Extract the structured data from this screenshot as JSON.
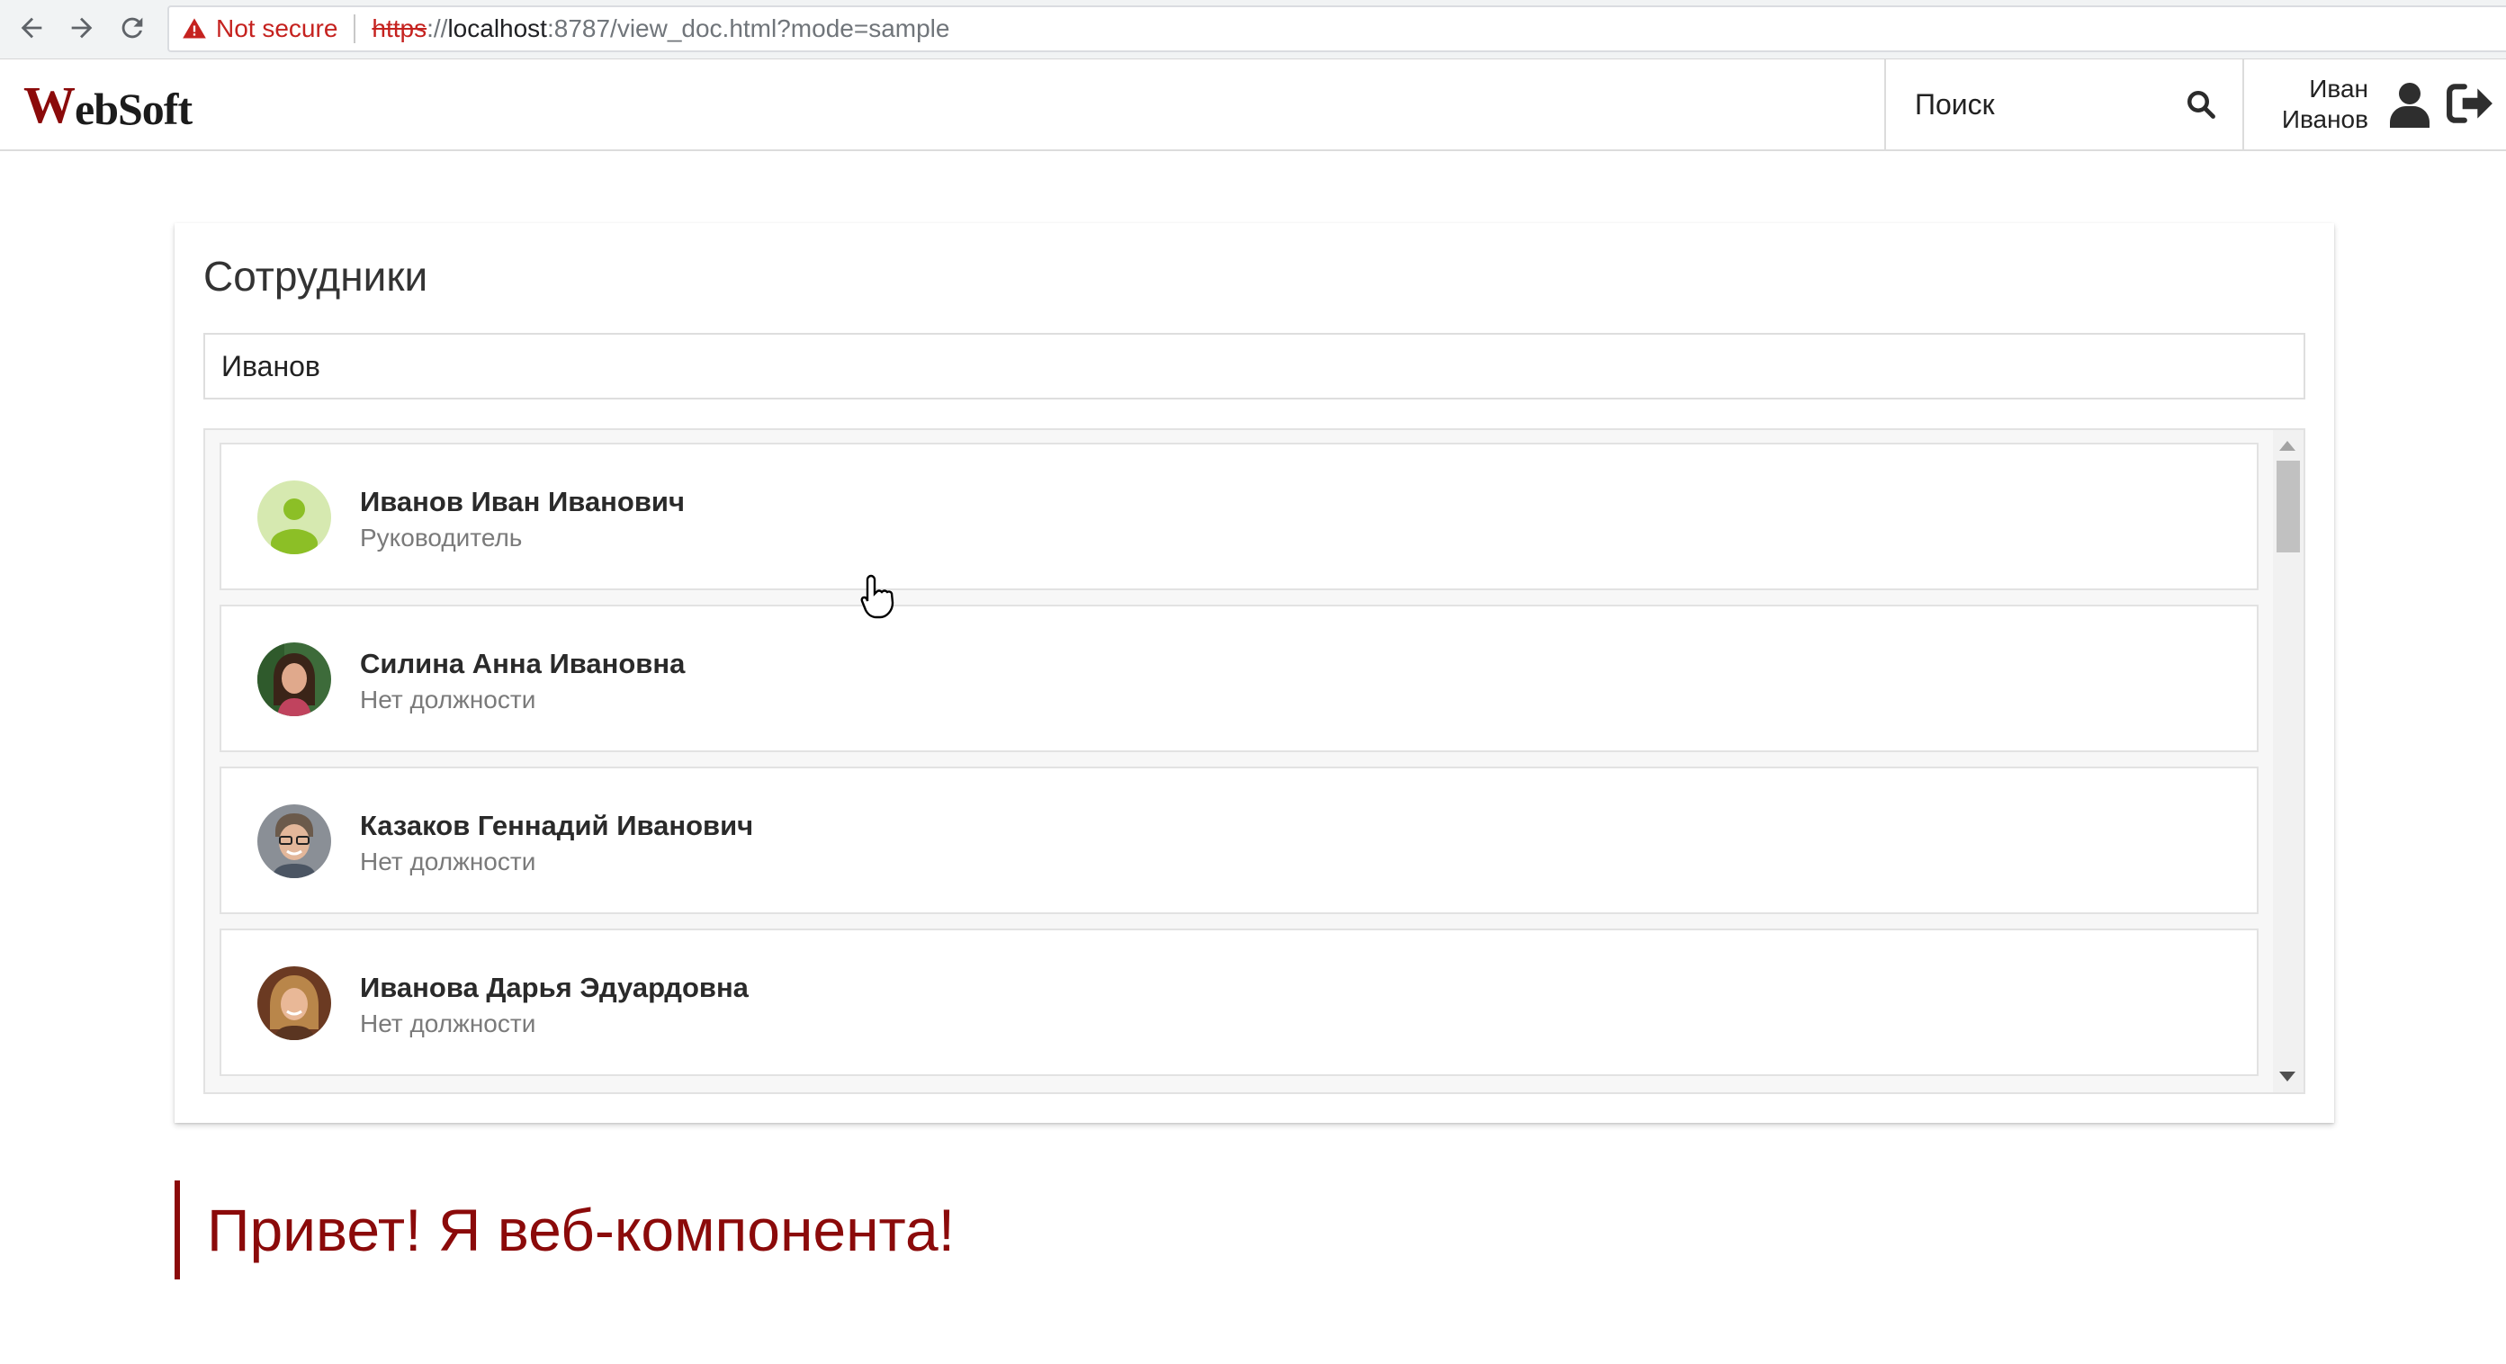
{
  "browser": {
    "security_label": "Not secure",
    "url_protocol": "https",
    "url_separator": "://",
    "url_host": "localhost",
    "url_rest": ":8787/view_doc.html?mode=sample"
  },
  "header": {
    "logo_w": "W",
    "logo_rest": "ebSoft",
    "search_label": "Поиск",
    "user_first_name": "Иван",
    "user_last_name": "Иванов"
  },
  "employees": {
    "title": "Сотрудники",
    "search_value": "Иванов",
    "list": [
      {
        "name": "Иванов Иван Иванович",
        "position": "Руководитель",
        "avatar": "default-avatar-icon"
      },
      {
        "name": "Силина Анна Ивановна",
        "position": "Нет должности",
        "avatar": "photo"
      },
      {
        "name": "Казаков Геннадий Иванович",
        "position": "Нет должности",
        "avatar": "photo"
      },
      {
        "name": "Иванова Дарья Эдуардовна",
        "position": "Нет должности",
        "avatar": "photo"
      }
    ]
  },
  "component": {
    "greeting": "Привет! Я веб-компонента!"
  },
  "colors": {
    "brand": "#8b0a0a",
    "default_avatar_bg": "#d6e9b0",
    "default_avatar_fg": "#8cbf26"
  }
}
